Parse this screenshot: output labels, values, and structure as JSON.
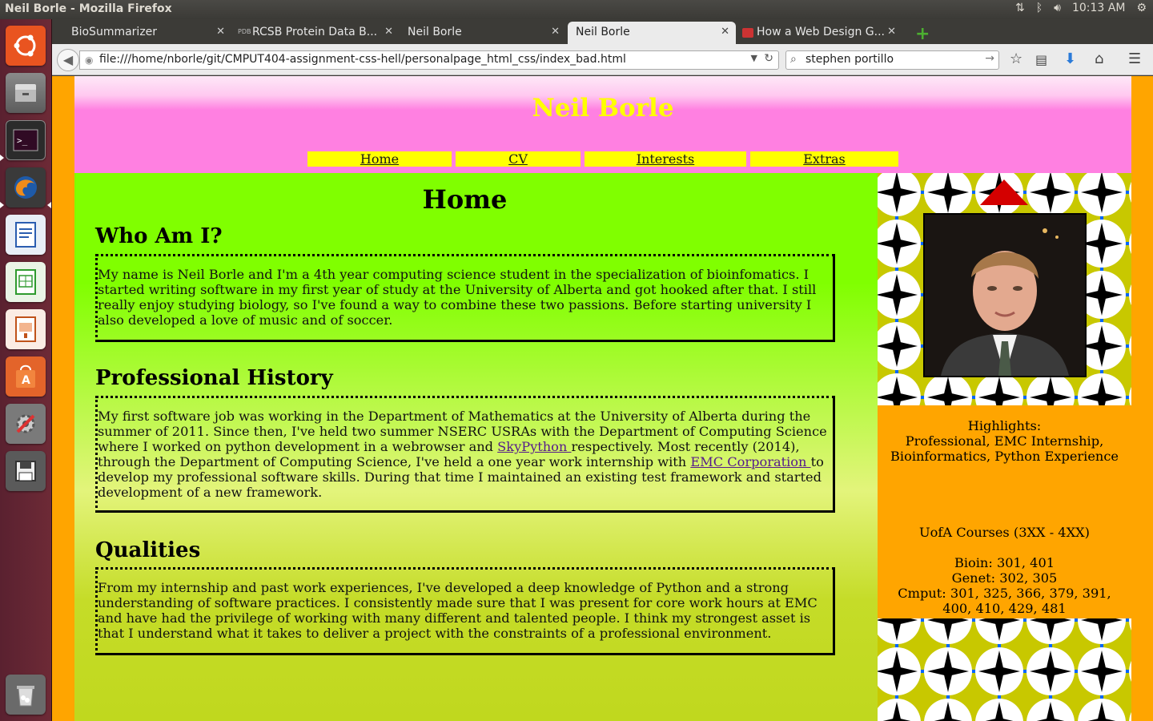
{
  "os": {
    "window_title": "Neil Borle - Mozilla Firefox",
    "clock": "10:13 AM",
    "launcher_items": [
      "ubuntu-dash",
      "files",
      "terminal",
      "firefox",
      "writer",
      "calc",
      "impress",
      "software-center",
      "system-settings",
      "save",
      "trash"
    ]
  },
  "browser": {
    "tabs": [
      {
        "label": "BioSummarizer"
      },
      {
        "label": "RCSB Protein Data B..."
      },
      {
        "label": "Neil Borle"
      },
      {
        "label": "Neil Borle"
      },
      {
        "label": "How a Web Design G..."
      }
    ],
    "active_tab": 3,
    "url": "file:///home/nborle/git/CMPUT404-assignment-css-hell/personalpage_html_css/index_bad.html",
    "search_text": "stephen portillo"
  },
  "page": {
    "site_title": "Neil Borle",
    "nav": [
      {
        "label": "Home"
      },
      {
        "label": "CV"
      },
      {
        "label": "Interests"
      },
      {
        "label": "Extras"
      }
    ],
    "heading": "Home",
    "sections": [
      {
        "title": "Who Am I?",
        "text": "My name is Neil Borle and I'm a 4th year computing science student in the specialization of bioinfomatics. I started writing software in my first year of study at the University of Alberta and got hooked after that. I still really enjoy studying biology, so I've found a way to combine these two passions. Before starting university I also developed a love of music and of soccer."
      },
      {
        "title": "Professional History",
        "text_1": "My first software job was working in the Department of Mathematics at the University of Alberta during the summer of 2011. Since then, I've held two summer NSERC USRAs with the Department of Computing Science where I worked on python development in a webrowser and ",
        "link_1": "SkyPython ",
        "text_2": "respectively. Most recently (2014), through the Department of Computing Science, I've held a one year work internship with ",
        "link_2": "EMC Corporation ",
        "text_3": "to develop my professional software skills. During that time I maintained an existing test framework and started development of a new framework."
      },
      {
        "title": "Qualities",
        "text": "From my internship and past work experiences, I've developed a deep knowledge of Python and a strong understanding of software practices. I consistently made sure that I was present for core work hours at EMC and have had the privilege of working with many different and talented people. I think my strongest asset is that I understand what it takes to deliver a project with the constraints of a professional environment."
      }
    ],
    "sidebar": {
      "highlights_title": "Highlights:",
      "highlights_line1": "Professional, EMC Internship,",
      "highlights_line2": "Bioinformatics, Python Experience",
      "courses_title": "UofA Courses (3XX - 4XX)",
      "courses_bioin": "Bioin: 301, 401",
      "courses_genet": "Genet: 302, 305",
      "courses_cmput_line1": "Cmput: 301, 325, 366, 379, 391,",
      "courses_cmput_line2": "400, 410, 429, 481"
    }
  },
  "colors": {
    "page_bg": "#ffa500",
    "header_pink": "#ff80e1",
    "title_yellow": "#ffff00",
    "main_green": "#80ff00",
    "pattern_blue": "#0066ff",
    "pattern_yellow": "#c8c800"
  }
}
